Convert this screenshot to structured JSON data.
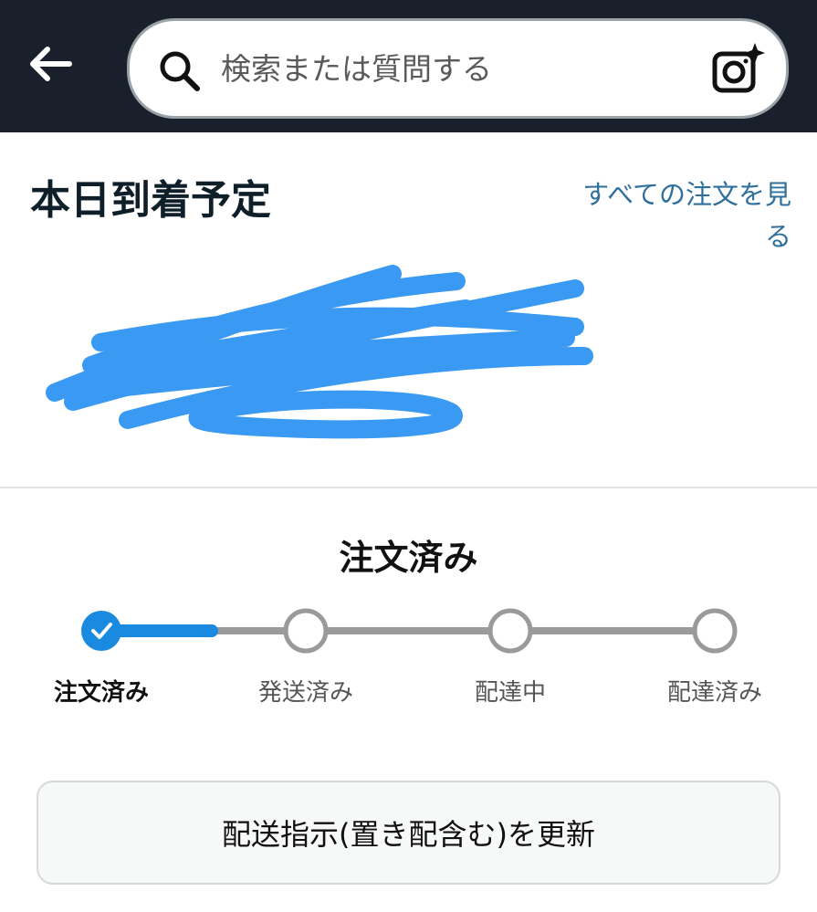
{
  "header": {
    "search_placeholder": "検索または質問する"
  },
  "delivery": {
    "title": "本日到着予定",
    "all_orders_link": "すべての注文を見る"
  },
  "status": {
    "title": "注文済み",
    "current_step": 0,
    "steps": [
      {
        "label": "注文済み",
        "state": "done"
      },
      {
        "label": "発送済み",
        "state": "pending"
      },
      {
        "label": "配達中",
        "state": "pending"
      },
      {
        "label": "配達済み",
        "state": "pending"
      }
    ],
    "progress_fraction": 0.18
  },
  "actions": {
    "update_delivery_label": "配送指示(置き配含む)を更新"
  },
  "colors": {
    "header_bg": "#19202b",
    "accent": "#1a8ae0",
    "link": "#2f6f9c",
    "redaction": "#3a99f2"
  },
  "icons": {
    "back": "arrow-left-icon",
    "search": "search-icon",
    "camera": "camera-sparkle-icon",
    "check": "check-icon"
  }
}
